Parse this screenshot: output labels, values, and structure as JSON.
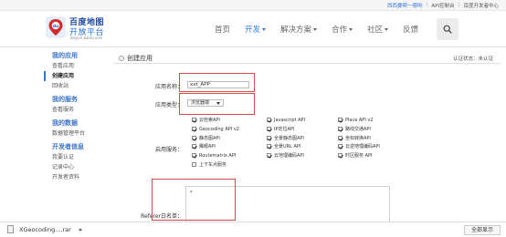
{
  "topbar": {
    "link1": "西西要啊一哪哟",
    "link2": "API控制台",
    "link3": "百度开发者中心"
  },
  "logo": {
    "line1": "百度地图",
    "line2": "开放平台",
    "line3": "lbsyun.baidu.com"
  },
  "nav": {
    "items": [
      {
        "label": "首页",
        "has_caret": false
      },
      {
        "label": "开发",
        "has_caret": true,
        "active": true
      },
      {
        "label": "解决方案",
        "has_caret": true
      },
      {
        "label": "合作",
        "has_caret": true
      },
      {
        "label": "社区",
        "has_caret": true
      },
      {
        "label": "反馈",
        "has_caret": false
      }
    ]
  },
  "sidebar": {
    "sections": [
      {
        "heading": "我的应用",
        "items": [
          "查看应用",
          "创建应用",
          "回收站"
        ]
      },
      {
        "heading": "我的服务",
        "items": [
          "查看服务"
        ]
      },
      {
        "heading": "我的数据",
        "items": [
          "数据管理平台"
        ]
      },
      {
        "heading": "开发者信息",
        "items": [
          "我要认证",
          "记录中心",
          "开发者资料"
        ]
      }
    ],
    "active_item": "创建应用"
  },
  "main": {
    "title": "创建应用",
    "cert_status": "认证状态：未认证",
    "app_name_label": "应用名称：",
    "app_name_value": "xxt_APP",
    "app_type_label": "应用类型：",
    "app_type_value": "浏览器端",
    "services_label": "启用服务：",
    "services": [
      {
        "label": "云检索API",
        "checked": true
      },
      {
        "label": "Javascript API",
        "checked": true
      },
      {
        "label": "Place API v2",
        "checked": true
      },
      {
        "label": "Geocoding API v2",
        "checked": true
      },
      {
        "label": "IP定位API",
        "checked": true
      },
      {
        "label": "路线交通API",
        "checked": true
      },
      {
        "label": "静态图API",
        "checked": true
      },
      {
        "label": "全景静态图API",
        "checked": true
      },
      {
        "label": "坐标转换API",
        "checked": true
      },
      {
        "label": "鹰眼API",
        "checked": true
      },
      {
        "label": "全景URL API",
        "checked": true
      },
      {
        "label": "云逆地理编码API",
        "checked": true
      },
      {
        "label": "Routematrix API",
        "checked": true
      },
      {
        "label": "云地理编码API",
        "checked": true
      },
      {
        "label": "时区服务 API",
        "checked": true
      },
      {
        "label": "上下车点服务",
        "checked": false
      }
    ],
    "referer_label": "Referer白名单：",
    "referer_value": "*"
  },
  "taskbar": {
    "file_name": "XGeocoding....rar",
    "show_all": "全部显示"
  },
  "colors": {
    "accent": "#2c7be5",
    "sidebar_heading": "#3d74c8",
    "highlight_box": "#d84a4a"
  }
}
